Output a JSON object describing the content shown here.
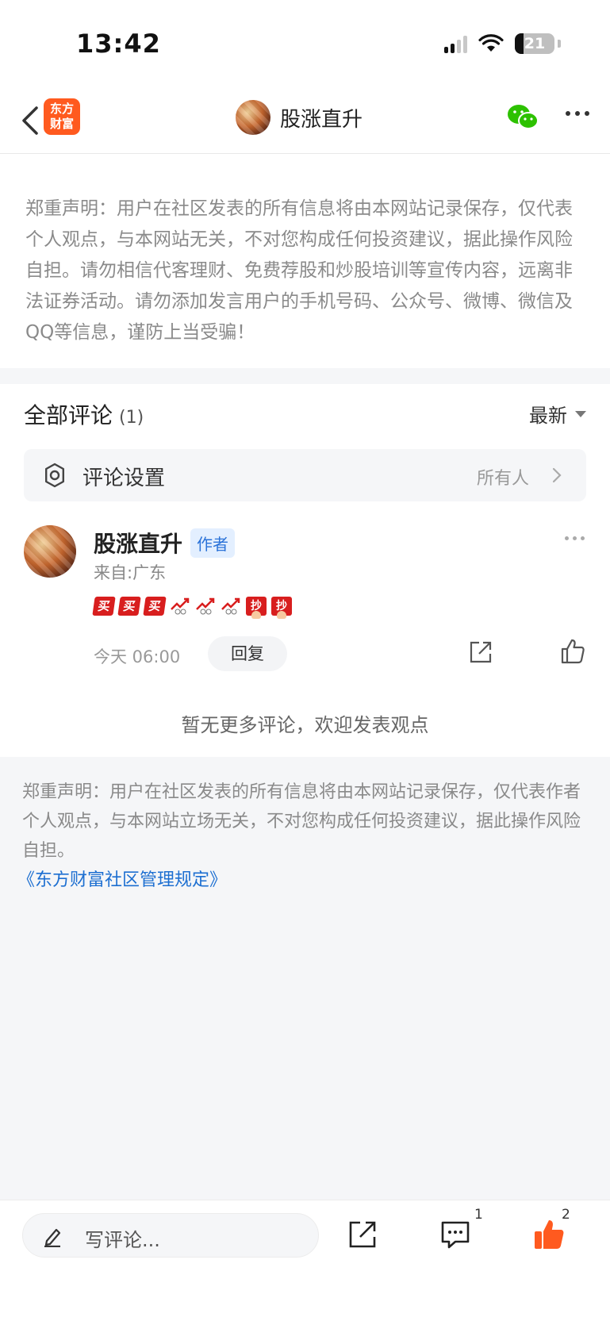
{
  "status_bar": {
    "time": "13:42",
    "battery": "21",
    "battery_level": 0.21
  },
  "nav": {
    "logo_line1": "东方",
    "logo_line2": "财富",
    "title": "股涨直升"
  },
  "notice_top": "郑重声明：用户在社区发表的所有信息将由本网站记录保存，仅代表个人观点，与本网站无关，不对您构成任何投资建议，据此操作风险自担。请勿相信代客理财、免费荐股和炒股培训等宣传内容，远离非法证券活动。请勿添加发言用户的手机号码、公众号、微博、微信及QQ等信息，谨防上当受骗！",
  "comments": {
    "header": "全部评论",
    "count": "(1)",
    "sort_label": "最新",
    "settings_label": "评论设置",
    "settings_value": "所有人",
    "items": [
      {
        "name": "股涨直升",
        "badge": "作者",
        "from": "来自:广东",
        "emoji_buy": "买",
        "emoji_grab": "抄",
        "time": "今天 06:00",
        "reply_label": "回复"
      }
    ],
    "no_more": "暂无更多评论，欢迎发表观点"
  },
  "notice_bottom": {
    "text": "郑重声明：用户在社区发表的所有信息将由本网站记录保存，仅代表作者个人观点，与本网站立场无关，不对您构成任何投资建议，据此操作风险自担。",
    "link": "《东方财富社区管理规定》"
  },
  "bottom_bar": {
    "input_placeholder": "写评论...",
    "comment_count": "1",
    "like_count": "2"
  },
  "colors": {
    "brand_orange": "#ff5a1f",
    "link_blue": "#1d6fd1",
    "badge_blue": "#2a72d8",
    "wechat_green": "#2dc100",
    "like_orange": "#ff5a1f",
    "emoji_red": "#d81e1e"
  }
}
